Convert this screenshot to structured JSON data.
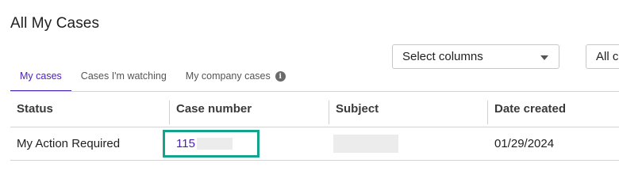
{
  "page": {
    "title": "All My Cases"
  },
  "controls": {
    "select_columns_label": "Select columns",
    "filter_select_label": "All c"
  },
  "tabs": [
    {
      "label": "My cases",
      "active": true
    },
    {
      "label": "Cases I'm watching",
      "active": false
    },
    {
      "label": "My company cases",
      "active": false,
      "icon": "info-icon"
    }
  ],
  "table": {
    "columns": [
      "Status",
      "Case number",
      "Subject",
      "Date created"
    ],
    "rows": [
      {
        "status": "My Action Required",
        "case_number": "115",
        "subject": "",
        "date_created": "01/29/2024"
      }
    ]
  },
  "colors": {
    "accent": "#4a1fb8",
    "highlight": "#14a38b"
  }
}
